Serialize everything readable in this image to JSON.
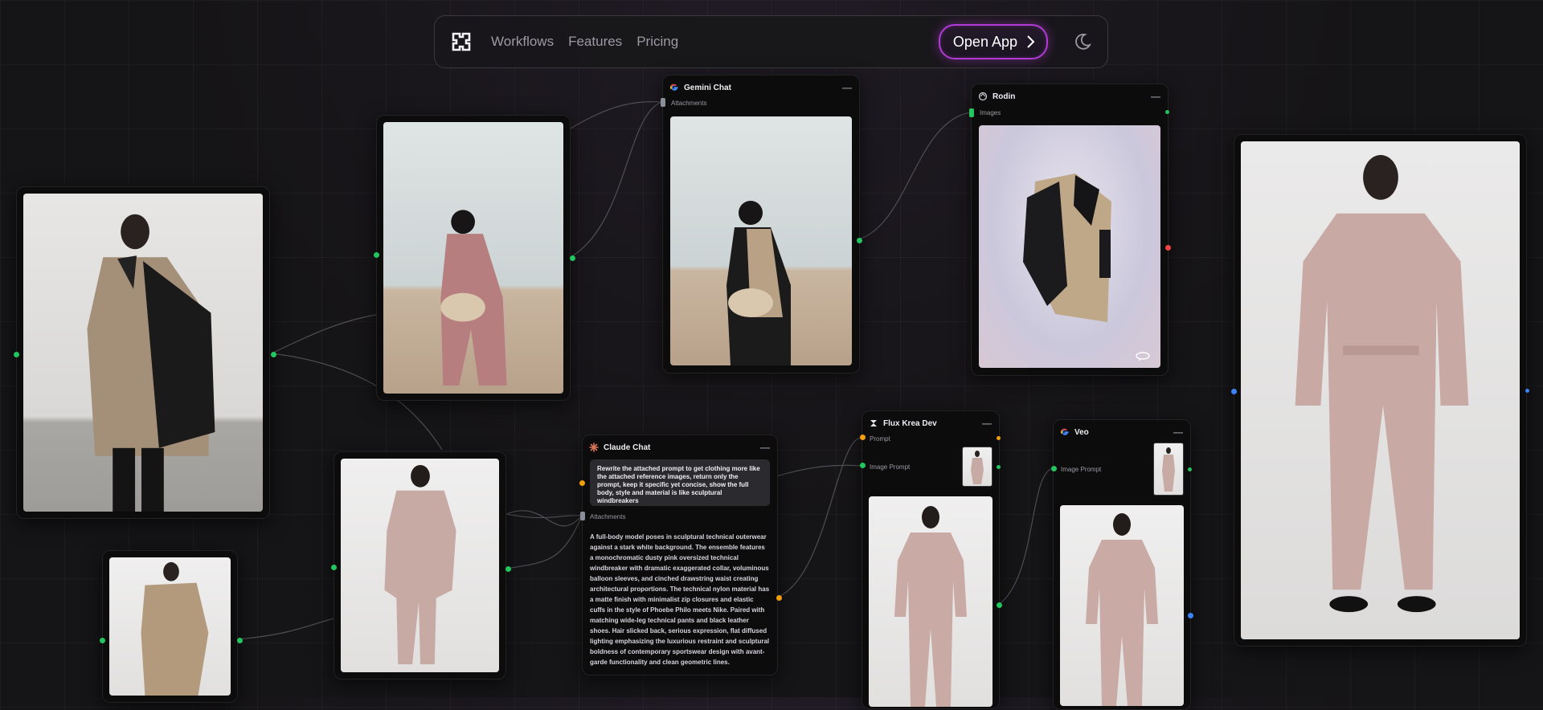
{
  "nav": {
    "links": [
      "Workflows",
      "Features",
      "Pricing"
    ],
    "open_app": "Open App"
  },
  "nodes": {
    "gemini": {
      "title": "Gemini Chat",
      "port": "Attachments"
    },
    "rodin": {
      "title": "Rodin",
      "port": "Images"
    },
    "claude": {
      "title": "Claude Chat",
      "prompt": "Rewrite the attached prompt to get clothing more like the attached reference images, return only the prompt, keep it specific yet concise, show the full body, style and material is like sculptural windbreakers",
      "port": "Attachments",
      "output": "A full-body model poses in sculptural technical outerwear against a stark white background. The ensemble features a monochromatic dusty pink oversized technical windbreaker with dramatic exaggerated collar, voluminous balloon sleeves, and cinched drawstring waist creating architectural proportions. The technical nylon material has a matte finish with minimalist zip closures and elastic cuffs in the style of Phoebe Philo meets Nike. Paired with matching wide-leg technical pants and black leather shoes. Hair slicked back, serious expression, flat diffused lighting emphasizing the luxurious restraint and sculptural boldness of contemporary sportswear design with avant-garde functionality and clean geometric lines."
    },
    "flux": {
      "title": "Flux Krea Dev",
      "port1": "Prompt",
      "port2": "Image Prompt"
    },
    "veo": {
      "title": "Veo",
      "port1": "Image Prompt"
    }
  },
  "colors": {
    "accent": "#b13bd6",
    "port_green": "#22c55e",
    "port_orange": "#f59e0b",
    "port_red": "#ef4444",
    "port_blue": "#3b82f6"
  },
  "icons": [
    "logo-icon",
    "chevron-right-icon",
    "moon-icon",
    "google-icon",
    "rodin-icon",
    "claude-icon",
    "flux-icon",
    "menu-dots-icon",
    "rotate-3d-icon"
  ]
}
